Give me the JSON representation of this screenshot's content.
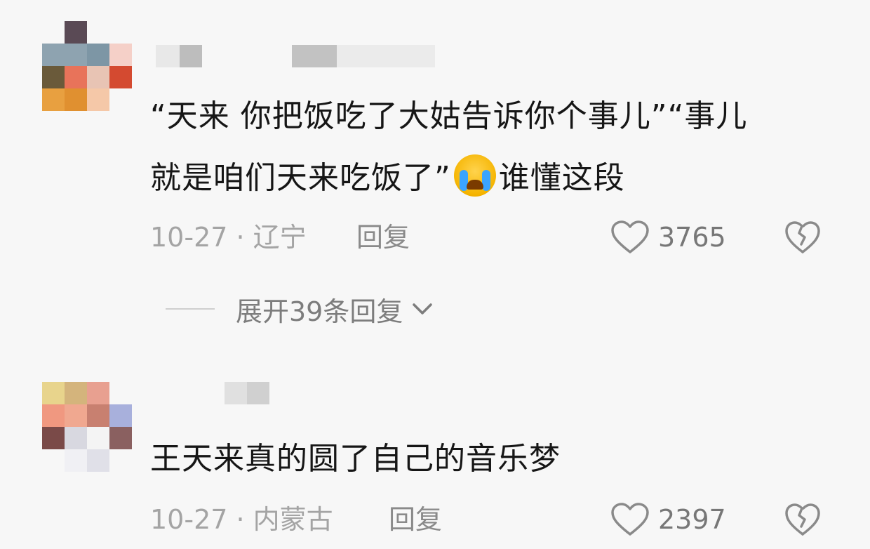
{
  "comments": [
    {
      "text_line1": "“天来 你把饭吃了大姑告诉你个事儿”“事儿",
      "text_line2_a": "就是咱们天来吃饭了”",
      "text_line2_b": "谁懂这段",
      "emoji": "loudly-crying-face-icon",
      "date_location": "10-27 · 辽宁",
      "reply_label": "回复",
      "likes": "3765",
      "expand_label": "展开39条回复"
    },
    {
      "text_line1": "王天来真的圆了自己的音乐梦",
      "date_location": "10-27 · 内蒙古",
      "reply_label": "回复",
      "likes": "2397"
    }
  ],
  "colors": {
    "text": "#161616",
    "meta": "#a4a4a4",
    "background": "#f7f7f7"
  }
}
